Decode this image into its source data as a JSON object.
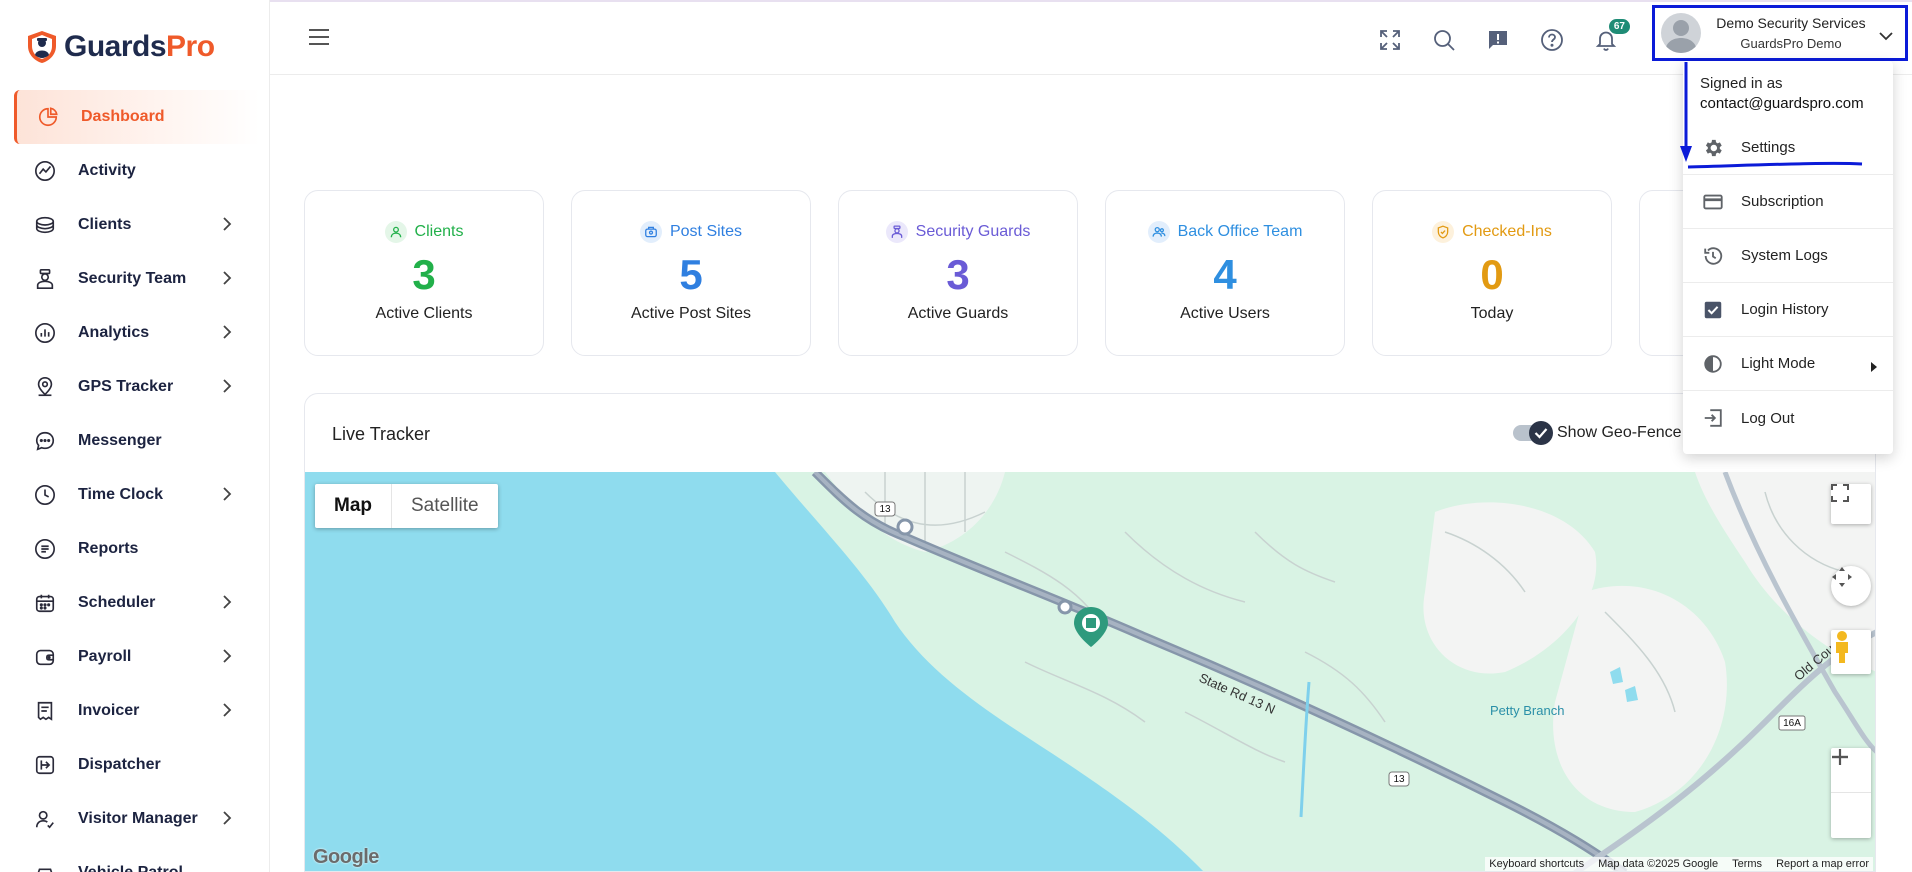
{
  "brand": {
    "name_part1": "Guards",
    "name_part2": "Pro",
    "color_primary": "#1f2b4d",
    "color_accent": "#ef5a2a"
  },
  "sidebar": {
    "items": [
      {
        "label": "Dashboard",
        "icon": "pie-chart-icon",
        "active": true,
        "has_children": false
      },
      {
        "label": "Activity",
        "icon": "activity-chart-icon",
        "has_children": false
      },
      {
        "label": "Clients",
        "icon": "briefcase-icon",
        "has_children": true
      },
      {
        "label": "Security Team",
        "icon": "guard-icon",
        "has_children": true
      },
      {
        "label": "Analytics",
        "icon": "bar-chart-icon",
        "has_children": true
      },
      {
        "label": "GPS Tracker",
        "icon": "location-pin-icon",
        "has_children": true
      },
      {
        "label": "Messenger",
        "icon": "chat-bubble-icon",
        "has_children": false
      },
      {
        "label": "Time Clock",
        "icon": "clock-icon",
        "has_children": true
      },
      {
        "label": "Reports",
        "icon": "report-icon",
        "has_children": false
      },
      {
        "label": "Scheduler",
        "icon": "calendar-icon",
        "has_children": true
      },
      {
        "label": "Payroll",
        "icon": "wallet-icon",
        "has_children": true
      },
      {
        "label": "Invoicer",
        "icon": "invoice-icon",
        "has_children": true
      },
      {
        "label": "Dispatcher",
        "icon": "dispatch-icon",
        "has_children": false
      },
      {
        "label": "Visitor Manager",
        "icon": "visitor-icon",
        "has_children": true
      },
      {
        "label": "Vehicle Patrol",
        "icon": "car-icon",
        "has_children": false
      }
    ]
  },
  "topbar": {
    "notification_count": "67",
    "profile": {
      "name": "Demo Security Services",
      "subtitle": "GuardsPro Demo"
    }
  },
  "stats": [
    {
      "title": "Clients",
      "value": "3",
      "caption": "Active Clients",
      "color": "#22b04a",
      "icon": "user-icon"
    },
    {
      "title": "Post Sites",
      "value": "5",
      "caption": "Active Post Sites",
      "color": "#2f7fe0",
      "icon": "post-site-icon"
    },
    {
      "title": "Security Guards",
      "value": "3",
      "caption": "Active Guards",
      "color": "#6a5bd6",
      "icon": "guard-icon"
    },
    {
      "title": "Back Office Team",
      "value": "4",
      "caption": "Active Users",
      "color": "#2f8fe0",
      "icon": "team-icon"
    },
    {
      "title": "Checked-Ins",
      "value": "0",
      "caption": "Today",
      "color": "#e29a12",
      "icon": "check-circle-icon"
    }
  ],
  "tracker": {
    "title": "Live Tracker",
    "geo_fence_label": "Show Geo-Fence",
    "map": {
      "type_map": "Map",
      "type_satellite": "Satellite",
      "road_label": "State Rd 13 N",
      "place_label": "Petty Branch",
      "road_label_2": "Old County",
      "shield_13": "13",
      "shield_16a": "16A",
      "footer": {
        "shortcuts": "Keyboard shortcuts",
        "data": "Map data ©2025 Google",
        "terms": "Terms",
        "report": "Report a map error"
      },
      "logo": "Google"
    }
  },
  "dropdown": {
    "signed_in_as": "Signed in as",
    "email": "contact@guardspro.com",
    "items": [
      {
        "label": "Settings",
        "icon": "gear-icon"
      },
      {
        "label": "Subscription",
        "icon": "credit-card-icon"
      },
      {
        "label": "System Logs",
        "icon": "history-icon"
      },
      {
        "label": "Login History",
        "icon": "checkbox-icon"
      },
      {
        "label": "Light Mode",
        "icon": "contrast-icon",
        "has_submenu": true
      },
      {
        "label": "Log Out",
        "icon": "logout-icon"
      }
    ]
  },
  "annotation_color": "#0b1bd8"
}
